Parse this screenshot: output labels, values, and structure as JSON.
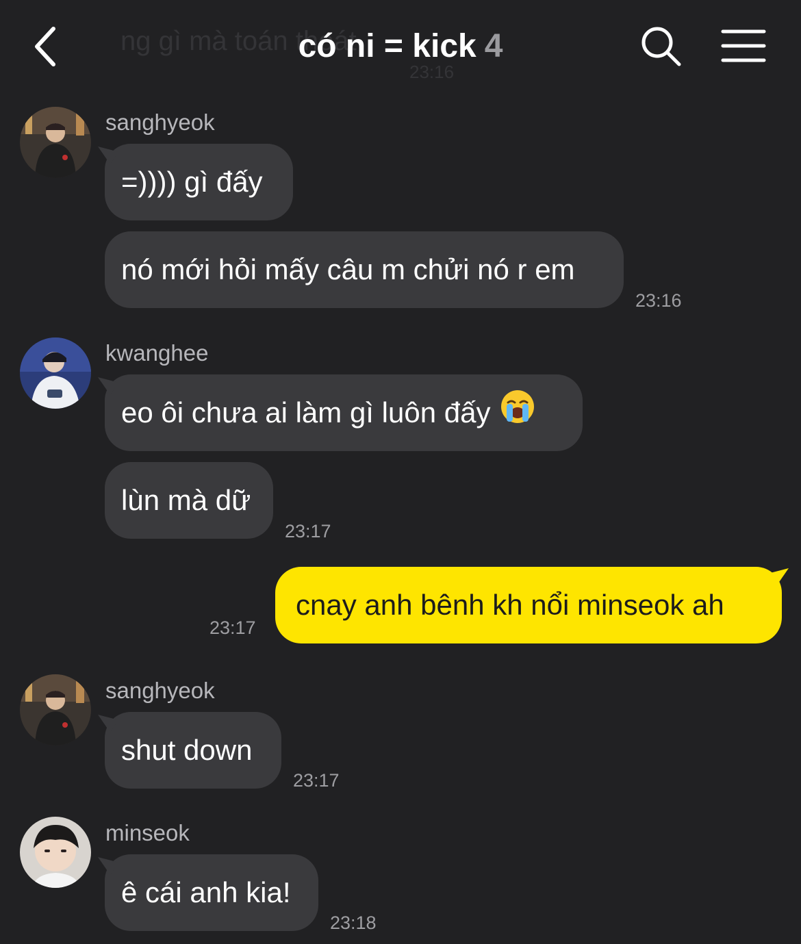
{
  "header": {
    "title": "có ni = kick",
    "member_count": "4",
    "ghost_text": "ng gì mà toán thoát",
    "ghost_time": "23:16"
  },
  "icons": {
    "back": "back-chevron-icon",
    "search": "search-icon",
    "menu": "hamburger-menu-icon"
  },
  "colors": {
    "background": "#212123",
    "bubble_other": "#3a3a3d",
    "bubble_mine": "#fee500",
    "timestamp": "#9e9ea2"
  },
  "messages": [
    {
      "sender": "sanghyeok",
      "bubbles": [
        "=)))) gì đấy",
        "nó mới hỏi mấy câu m chửi nó r em"
      ],
      "time": "23:16"
    },
    {
      "sender": "kwanghee",
      "bubbles": [
        "eo ôi chưa ai làm gì luôn đấy",
        "lùn mà dữ"
      ],
      "emoji": "loudly-crying-face",
      "time": "23:17"
    },
    {
      "sender": "me",
      "bubbles": [
        "cnay anh bênh kh nổi minseok ah"
      ],
      "time": "23:17"
    },
    {
      "sender": "sanghyeok",
      "bubbles": [
        "shut down"
      ],
      "time": "23:17"
    },
    {
      "sender": "minseok",
      "bubbles": [
        "ê cái anh kia!"
      ],
      "time": "23:18"
    }
  ]
}
